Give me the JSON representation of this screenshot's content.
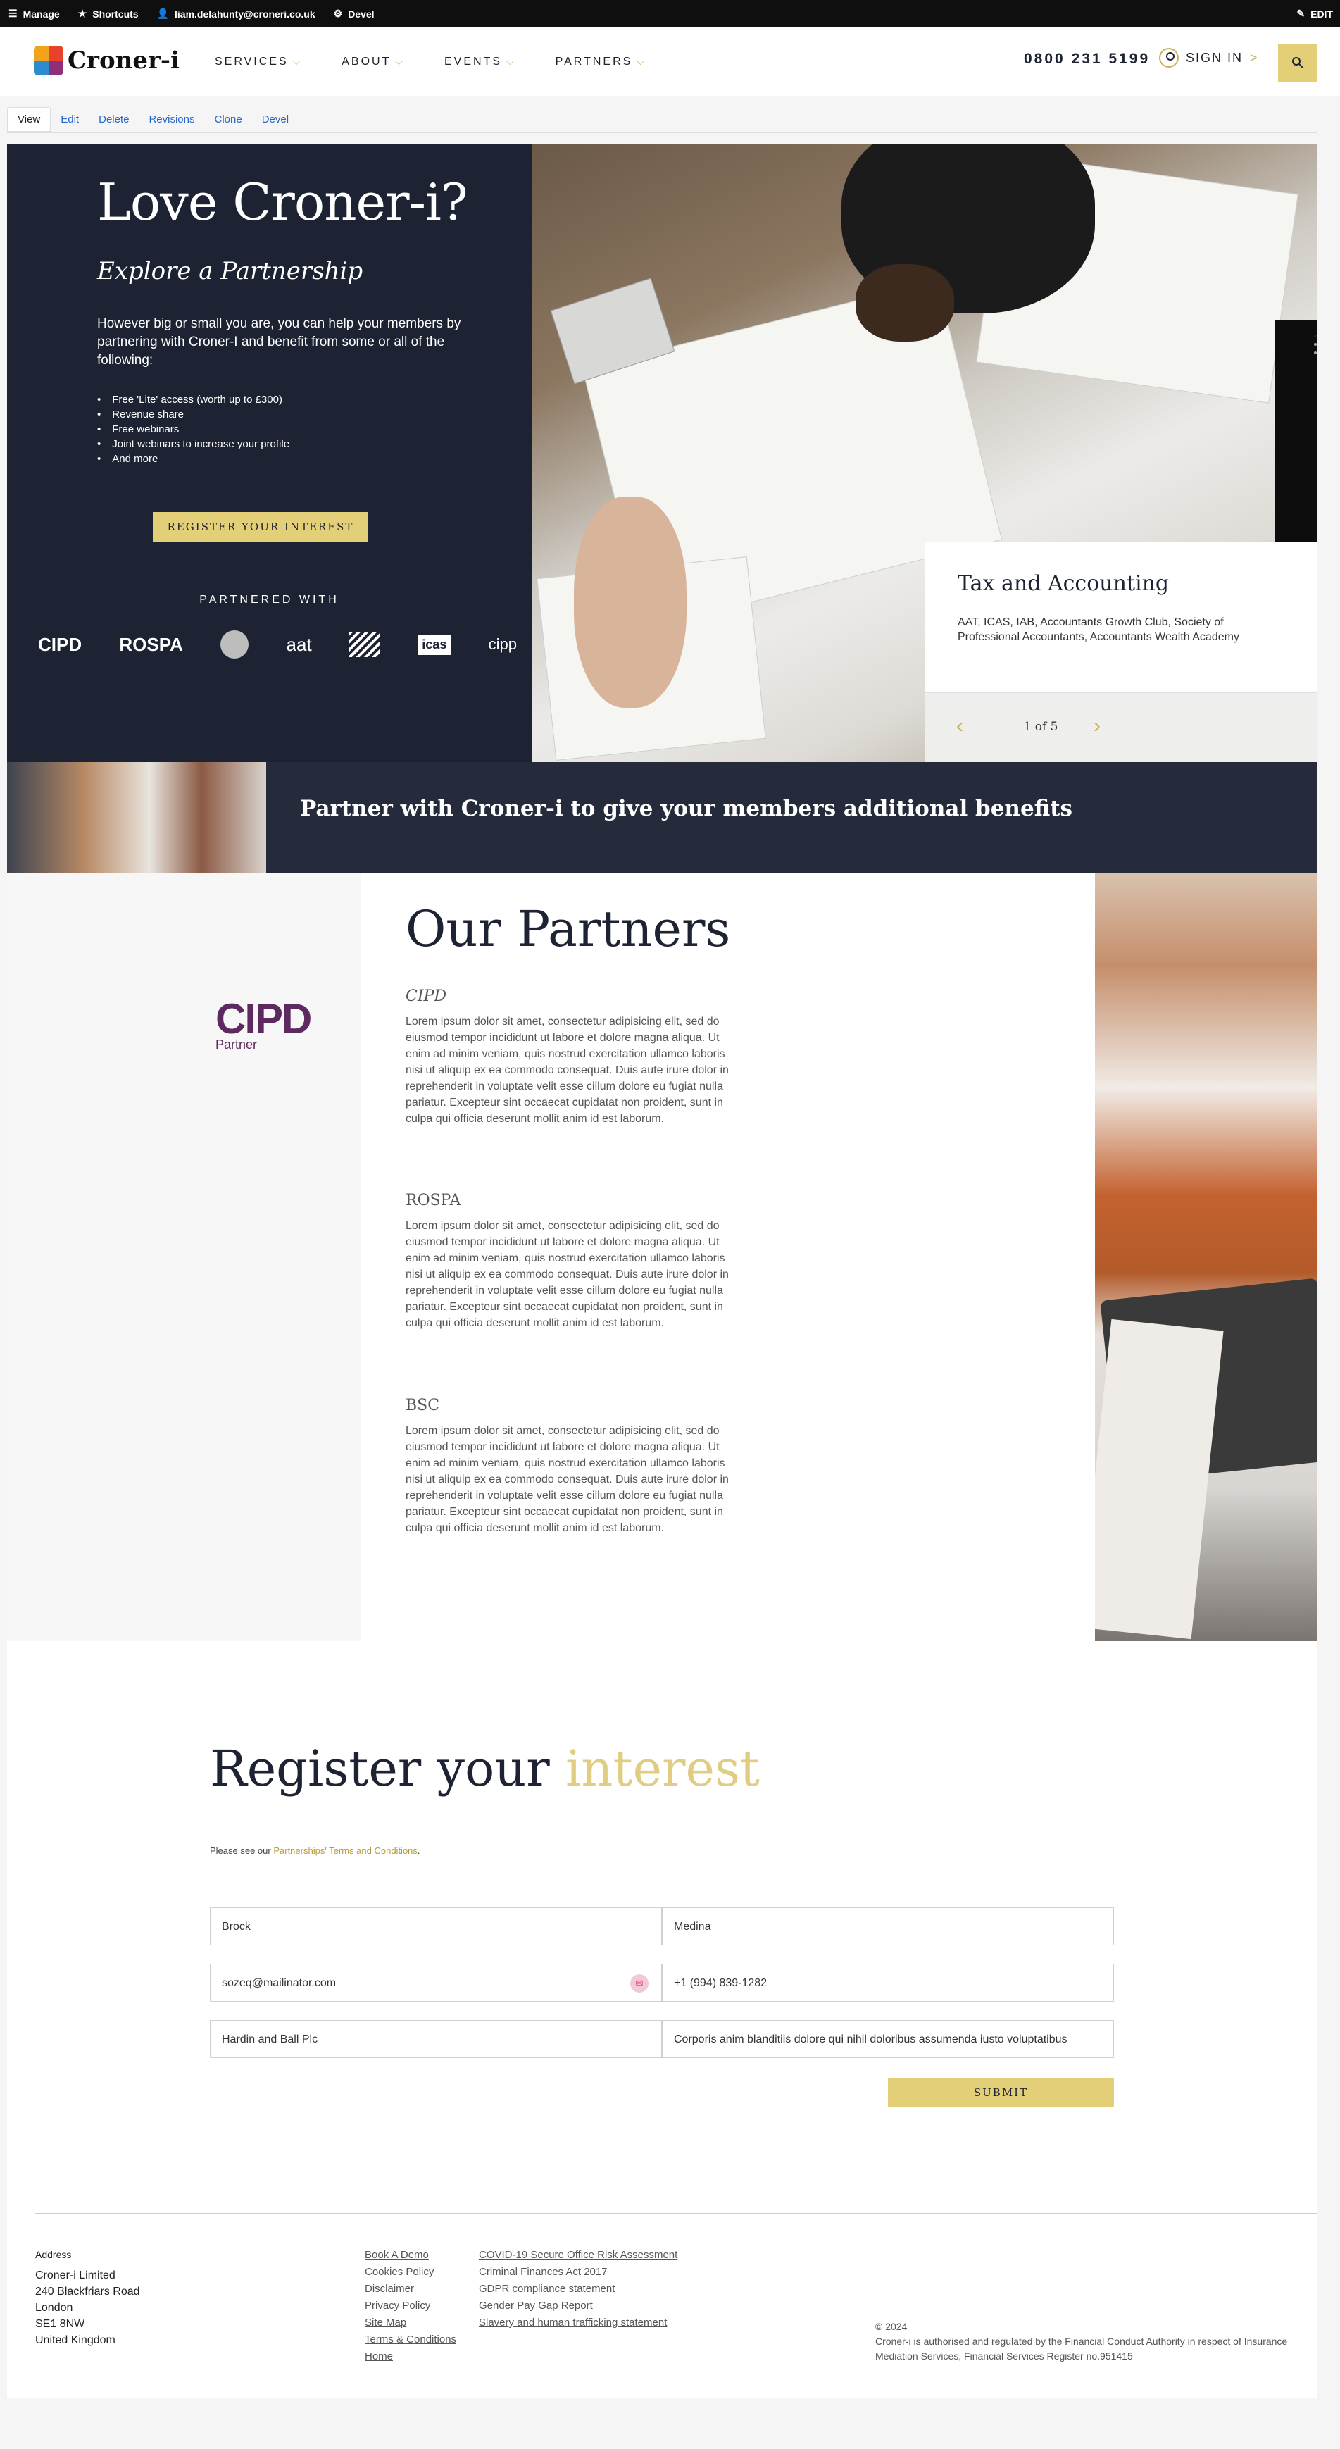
{
  "admin_bar": {
    "items": [
      "Manage",
      "Shortcuts",
      "liam.delahunty@croneri.co.uk",
      "Devel"
    ],
    "edit": "EDIT"
  },
  "header": {
    "logo_text": "Croner-i",
    "nav": [
      "SERVICES",
      "ABOUT",
      "EVENTS",
      "PARTNERS"
    ],
    "phone": "0800 231 5199",
    "sign_in": "SIGN IN",
    "sign_in_arrow": ">"
  },
  "tabs": [
    "View",
    "Edit",
    "Delete",
    "Revisions",
    "Clone",
    "Devel"
  ],
  "hero": {
    "title": "Love Croner-i?",
    "subtitle": "Explore a Partnership",
    "intro": "However big or small you are, you can help your members by partnering with Croner-I and benefit from some or all of the following:",
    "benefits": [
      "Free 'Lite' access (worth up to £300)",
      "Revenue share",
      "Free webinars",
      "Joint webinars to increase your profile",
      "And more"
    ],
    "cta": "REGISTER YOUR INTEREST",
    "partnered_with": "PARTNERED WITH",
    "partner_logos": [
      "CIPD",
      "ROSPA",
      "",
      "aat",
      "",
      "icas",
      "cipp"
    ]
  },
  "carousel": {
    "title": "Tax and Accounting",
    "description": "AAT, ICAS, IAB, Accountants Growth Club, Society of Professional Accountants, Accountants Wealth Academy",
    "counter": "1 of 5"
  },
  "band": {
    "title": "Partner with Croner-i to give your members additional benefits"
  },
  "partners": {
    "heading": "Our Partners",
    "logo_main": "CIPD",
    "logo_sub": "Partner",
    "items": [
      {
        "name": "CIPD",
        "text": "Lorem ipsum dolor sit amet, consectetur adipisicing elit, sed do eiusmod tempor incididunt ut labore et dolore magna aliqua. Ut enim ad minim veniam, quis nostrud exercitation ullamco laboris nisi ut aliquip ex ea commodo consequat. Duis aute irure dolor in reprehenderit in voluptate velit esse cillum dolore eu fugiat nulla pariatur. Excepteur sint occaecat cupidatat non proident, sunt in culpa qui officia deserunt mollit anim id est laborum."
      },
      {
        "name": "ROSPA",
        "text": "Lorem ipsum dolor sit amet, consectetur adipisicing elit, sed do eiusmod tempor incididunt ut labore et dolore magna aliqua. Ut enim ad minim veniam, quis nostrud exercitation ullamco laboris nisi ut aliquip ex ea commodo consequat. Duis aute irure dolor in reprehenderit in voluptate velit esse cillum dolore eu fugiat nulla pariatur. Excepteur sint occaecat cupidatat non proident, sunt in culpa qui officia deserunt mollit anim id est laborum."
      },
      {
        "name": "BSC",
        "text": "Lorem ipsum dolor sit amet, consectetur adipisicing elit, sed do eiusmod tempor incididunt ut labore et dolore magna aliqua. Ut enim ad minim veniam, quis nostrud exercitation ullamco laboris nisi ut aliquip ex ea commodo consequat. Duis aute irure dolor in reprehenderit in voluptate velit esse cillum dolore eu fugiat nulla pariatur. Excepteur sint occaecat cupidatat non proident, sunt in culpa qui officia deserunt mollit anim id est laborum."
      }
    ]
  },
  "register": {
    "heading": "Register your",
    "heading_accent": "interest",
    "terms_prefix": "Please see our ",
    "terms_link": "Partnerships' Terms and Conditions",
    "terms_suffix": ".",
    "fields": {
      "first_name": "Brock",
      "last_name": "Medina",
      "email": "sozeq@mailinator.com",
      "phone": "+1 (994) 839-1282",
      "company": "Hardin and Ball Plc",
      "message": "Corporis anim blanditiis dolore qui nihil doloribus assumenda iusto voluptatibus"
    },
    "submit": "SUBMIT"
  },
  "footer": {
    "address_label": "Address",
    "address": [
      "Croner-i Limited",
      "240 Blackfriars Road",
      "London",
      "SE1 8NW",
      "United Kingdom"
    ],
    "links_col1": [
      "Book A Demo",
      "Cookies Policy",
      "Disclaimer",
      "Privacy Policy",
      "Site Map",
      "Terms & Conditions",
      "Home"
    ],
    "links_col2": [
      "COVID-19 Secure Office Risk Assessment",
      "Criminal Finances Act 2017",
      "GDPR compliance statement",
      "Gender Pay Gap Report",
      "Slavery and human trafficking statement"
    ],
    "copyright": "© 2024",
    "legal": "Croner-i is authorised and regulated by the Financial Conduct Authority in respect of Insurance Mediation Services, Financial Services Register no.951415"
  },
  "colors": {
    "navy": "#1d2333",
    "gold": "#e3cf78",
    "link": "#2866c7"
  }
}
